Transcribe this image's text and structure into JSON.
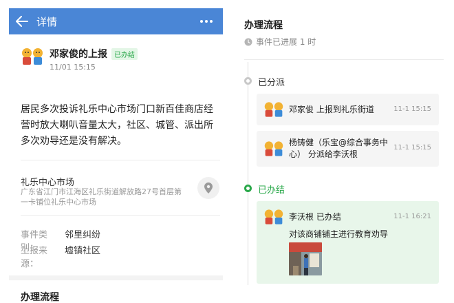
{
  "header": {
    "title": "详情"
  },
  "report": {
    "reporter_name": "邓家俊的上报",
    "status_badge": "已办结",
    "date": "11/01 15:15",
    "description": "居民多次投诉礼乐中心市场门口新百佳商店经营时放大喇叭音量太大，社区、城管、派出所多次劝导还是没有解决。"
  },
  "location": {
    "name": "礼乐中心市场",
    "address": "广东省江门市江海区礼乐街道解放路27号首层第一卡铺位礼乐中心市场"
  },
  "meta": {
    "category_label": "事件类别：",
    "category_value": "邻里纠纷",
    "source_label": "上报来源：",
    "source_value": "墟镇社区"
  },
  "flow": {
    "title_left": "办理流程",
    "title_right": "办理流程",
    "progress_text": "事件已进展 1 时",
    "stages": [
      {
        "label": "已分派",
        "entries": [
          {
            "text": "邓家俊 上报到礼乐街道",
            "time": "11-1 15:15"
          },
          {
            "text": "杨铸健（乐宝@综合事务中心） 分派给李沃根",
            "time": "11-1 15:15"
          }
        ]
      },
      {
        "label": "已办结",
        "entries": [
          {
            "text": "李沃根 已办结",
            "time": "11-1 16:21",
            "detail": "对该商铺铺主进行教育劝导"
          }
        ]
      }
    ]
  },
  "colors": {
    "header_bg": "#4a86d6",
    "green": "#2aa84a",
    "grey_dot": "#c8c8c8"
  },
  "icons": [
    "back-arrow-icon",
    "more-dots-icon",
    "location-pin-icon",
    "clock-icon"
  ]
}
